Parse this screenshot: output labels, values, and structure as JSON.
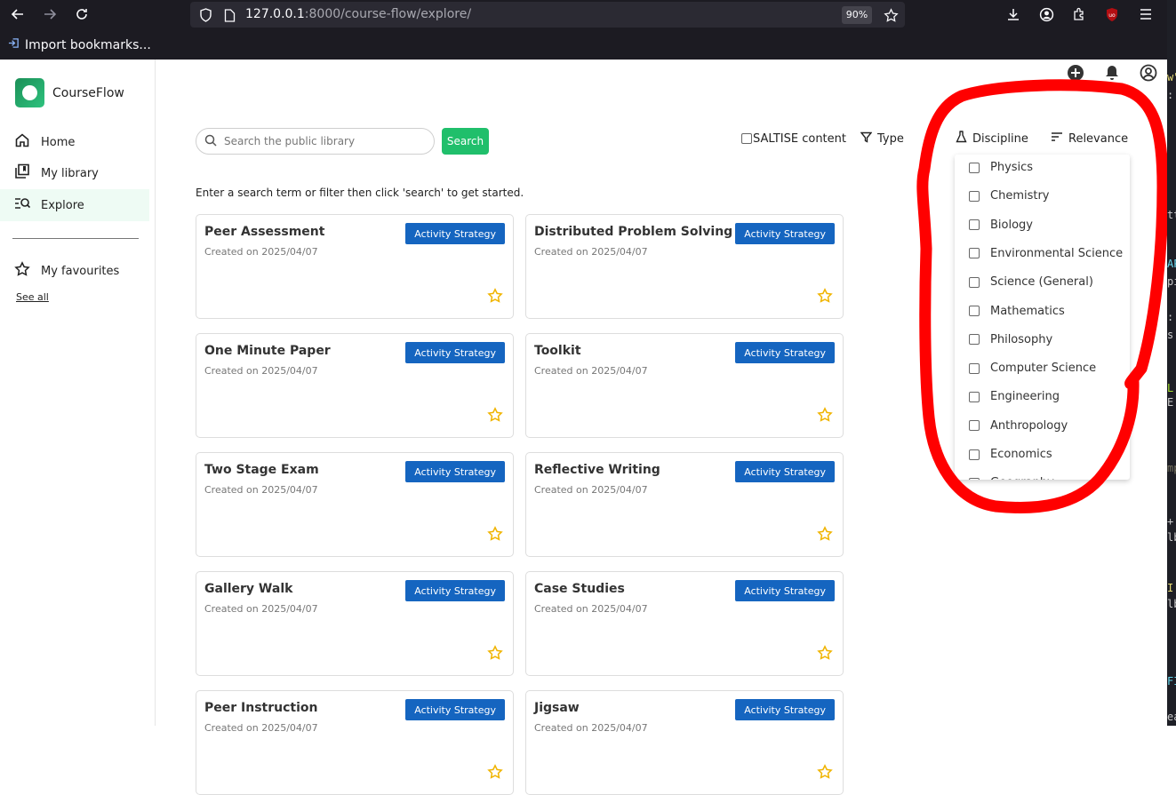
{
  "browser": {
    "url_host": "127.0.0.1",
    "url_path": ":8000/course-flow/explore/",
    "zoom": "90%",
    "bookmark_import": "Import bookmarks..."
  },
  "colors": {
    "accent_green": "#20bf6b",
    "badge_blue": "#1565c0",
    "star_gold": "#f0b400",
    "annotation_red": "#ff0000",
    "active_nav_bg": "#eefbf4"
  },
  "sidebar": {
    "brand": "CourseFlow",
    "items": [
      {
        "label": "Home",
        "icon": "home-icon"
      },
      {
        "label": "My library",
        "icon": "library-icon"
      },
      {
        "label": "Explore",
        "icon": "explore-icon",
        "active": true
      }
    ],
    "favourites_label": "My favourites",
    "see_all": "See all"
  },
  "header_icons": [
    "add-circle-icon",
    "bell-icon",
    "account-icon"
  ],
  "search": {
    "placeholder": "Search the public library",
    "value": "",
    "button": "Search"
  },
  "filters": {
    "saltise": "SALTISE content",
    "saltise_checked": false,
    "type": "Type",
    "discipline": "Discipline",
    "sort": "Relevance"
  },
  "hint": "Enter a search term or filter then click 'search' to get started.",
  "cards": [
    {
      "title": "Peer Assessment",
      "date": "Created on 2025/04/07",
      "badge": "Activity Strategy"
    },
    {
      "title": "Distributed Problem Solving",
      "date": "Created on 2025/04/07",
      "badge": "Activity Strategy"
    },
    {
      "title": "One Minute Paper",
      "date": "Created on 2025/04/07",
      "badge": "Activity Strategy"
    },
    {
      "title": "Toolkit",
      "date": "Created on 2025/04/07",
      "badge": "Activity Strategy"
    },
    {
      "title": "Two Stage Exam",
      "date": "Created on 2025/04/07",
      "badge": "Activity Strategy"
    },
    {
      "title": "Reflective Writing",
      "date": "Created on 2025/04/07",
      "badge": "Activity Strategy"
    },
    {
      "title": "Gallery Walk",
      "date": "Created on 2025/04/07",
      "badge": "Activity Strategy"
    },
    {
      "title": "Case Studies",
      "date": "Created on 2025/04/07",
      "badge": "Activity Strategy"
    },
    {
      "title": "Peer Instruction",
      "date": "Created on 2025/04/07",
      "badge": "Activity Strategy"
    },
    {
      "title": "Jigsaw",
      "date": "Created on 2025/04/07",
      "badge": "Activity Strategy"
    }
  ],
  "disciplines": [
    "Physics",
    "Chemistry",
    "Biology",
    "Environmental Science",
    "Science (General)",
    "Mathematics",
    "Philosophy",
    "Computer Science",
    "Engineering",
    "Anthropology",
    "Economics",
    "Geography"
  ]
}
